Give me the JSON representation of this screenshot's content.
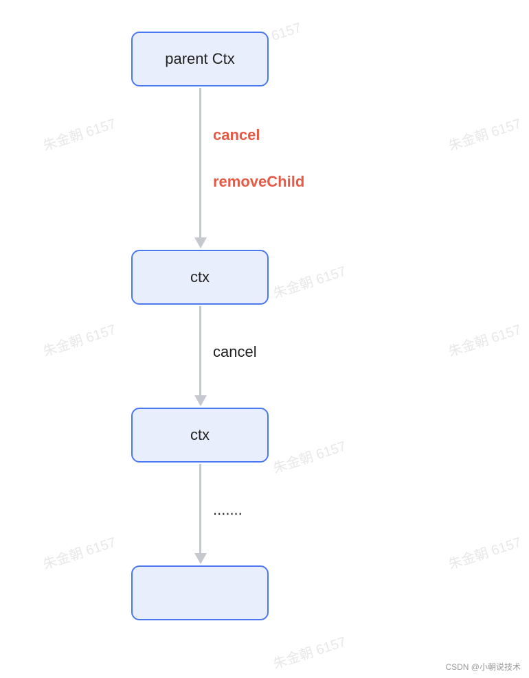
{
  "nodes": {
    "n1": "parent Ctx",
    "n2": "ctx",
    "n3": "ctx",
    "n4": ""
  },
  "edges": {
    "e1_label_a": "cancel",
    "e1_label_b": "removeChild",
    "e2_label": "cancel",
    "e3_label": "......."
  },
  "watermark_text": "朱金朝 6157",
  "footer": "CSDN @小朝说技术",
  "colors": {
    "node_fill": "#e8eefb",
    "node_border": "#4a78f0",
    "arrow": "#c5c9cf",
    "accent_red": "#e65a45"
  }
}
